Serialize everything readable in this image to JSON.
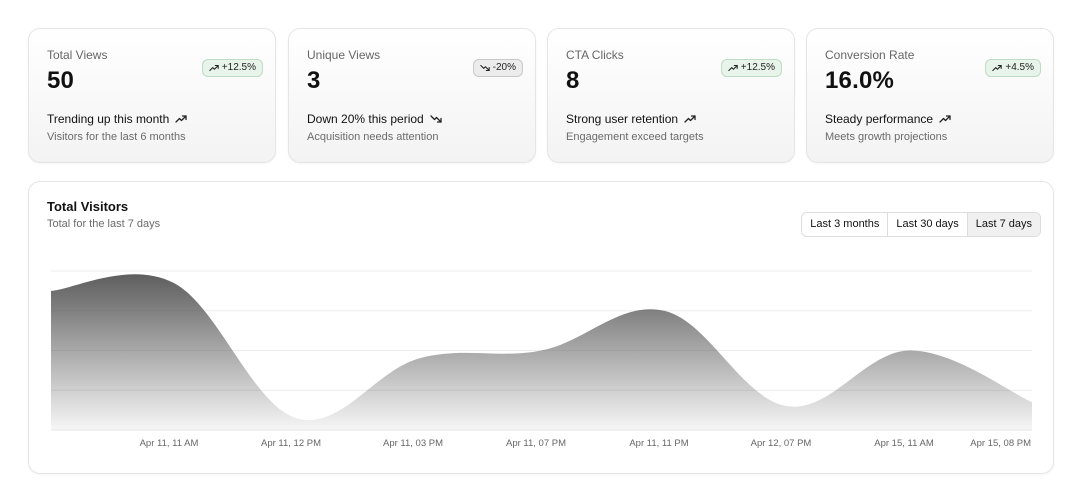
{
  "stats": [
    {
      "label": "Total Views",
      "value": "50",
      "badge": "+12.5%",
      "trend": "up",
      "headline": "Trending up this month",
      "sub": "Visitors for the last 6 months"
    },
    {
      "label": "Unique Views",
      "value": "3",
      "badge": "-20%",
      "trend": "down",
      "headline": "Down 20% this period",
      "sub": "Acquisition needs attention"
    },
    {
      "label": "CTA Clicks",
      "value": "8",
      "badge": "+12.5%",
      "trend": "up",
      "headline": "Strong user retention",
      "sub": "Engagement exceed targets"
    },
    {
      "label": "Conversion Rate",
      "value": "16.0%",
      "badge": "+4.5%",
      "trend": "up",
      "headline": "Steady performance",
      "sub": "Meets growth projections"
    }
  ],
  "chart": {
    "title": "Total Visitors",
    "subtitle": "Total for the last 7 days",
    "ranges": [
      "Last 3 months",
      "Last 30 days",
      "Last 7 days"
    ],
    "active_range": "Last 7 days"
  },
  "chart_data": {
    "type": "area",
    "title": "Total Visitors",
    "subtitle": "Total for the last 7 days",
    "xlabel": "",
    "ylabel": "",
    "x": [
      "Apr 11, 11 AM",
      "Apr 11, 12 PM",
      "Apr 11, 03 PM",
      "Apr 11, 07 PM",
      "Apr 11, 11 PM",
      "Apr 12, 07 PM",
      "Apr 15, 11 AM",
      "Apr 15, 08 PM"
    ],
    "tick_labels": [
      "Apr 11, 11 AM",
      "Apr 11, 12 PM",
      "Apr 11, 03 PM",
      "Apr 11, 07 PM",
      "Apr 11, 11 PM",
      "Apr 12, 07 PM",
      "Apr 15, 11 AM",
      "Apr 15, 08 PM"
    ],
    "series": [
      {
        "values": [
          3.5,
          3.7,
          0.3,
          1.8,
          2.0,
          3.0,
          0.6,
          2.0,
          0.7
        ]
      }
    ],
    "ylim": [
      0,
      4
    ],
    "grid": true,
    "color": "#555555"
  }
}
